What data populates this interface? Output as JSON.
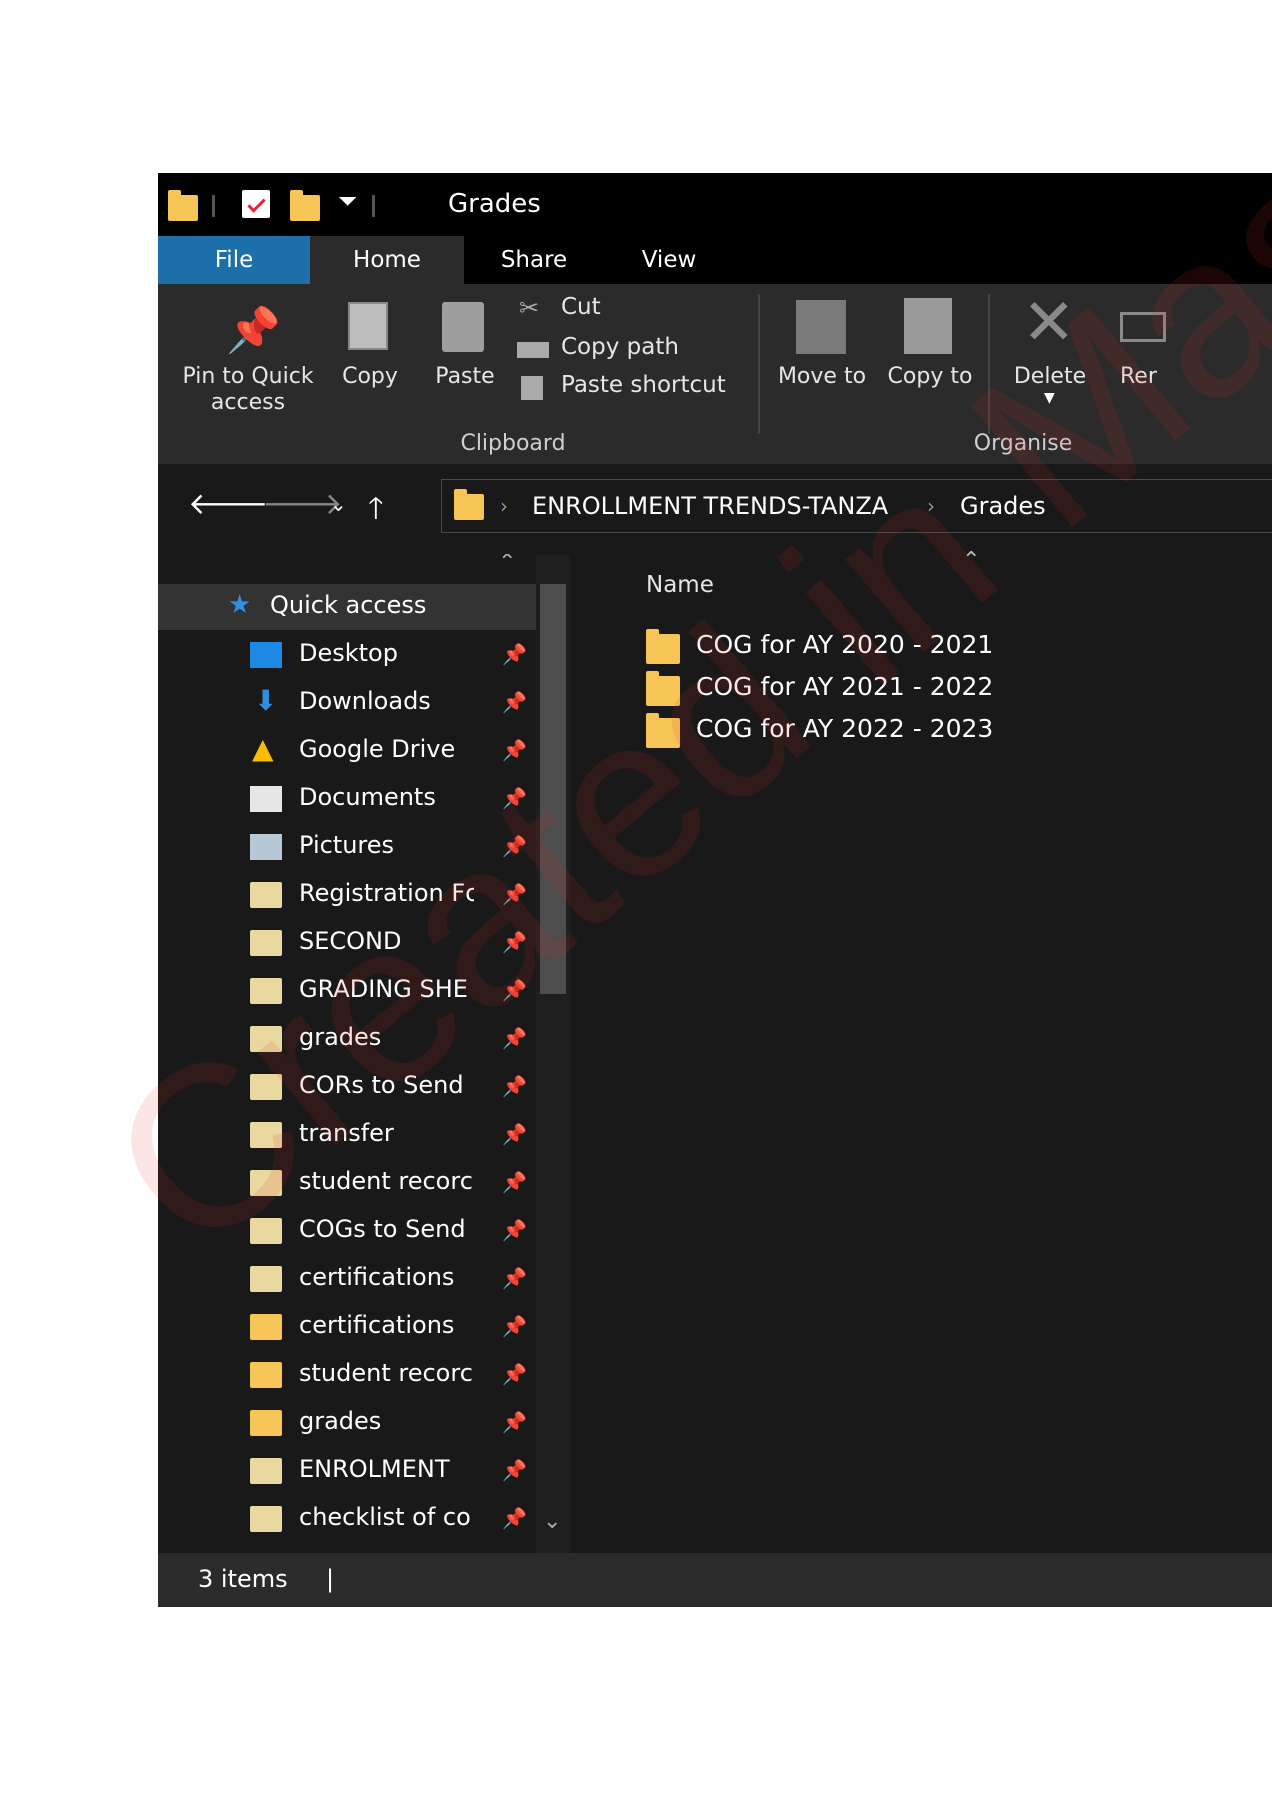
{
  "window": {
    "title": "Grades"
  },
  "tabs": [
    {
      "label": "File"
    },
    {
      "label": "Home"
    },
    {
      "label": "Share"
    },
    {
      "label": "View"
    }
  ],
  "ribbon": {
    "pin_label": "Pin to Quick access",
    "copy_label": "Copy",
    "paste_label": "Paste",
    "cut_label": "Cut",
    "copy_path_label": "Copy path",
    "paste_shortcut_label": "Paste shortcut",
    "clipboard_group": "Clipboard",
    "move_to_label": "Move to",
    "copy_to_label": "Copy to",
    "delete_label": "Delete",
    "rename_label": "Rer",
    "organise_group": "Organise"
  },
  "address": {
    "crumbs": [
      "ENROLLMENT TRENDS-TANZA",
      "Grades"
    ]
  },
  "navpane": {
    "quick_access": "Quick access",
    "items": [
      {
        "label": "Desktop",
        "icon": "desktop-icon"
      },
      {
        "label": "Downloads",
        "icon": "downloads-icon"
      },
      {
        "label": "Google Drive",
        "icon": "google-drive-icon"
      },
      {
        "label": "Documents",
        "icon": "documents-icon"
      },
      {
        "label": "Pictures",
        "icon": "pictures-icon"
      },
      {
        "label": "Registration Fc",
        "icon": "shared-folder-icon"
      },
      {
        "label": "SECOND",
        "icon": "cloud-folder-icon"
      },
      {
        "label": "GRADING SHE",
        "icon": "shared-folder-icon"
      },
      {
        "label": "grades",
        "icon": "cloud-folder-icon"
      },
      {
        "label": "CORs to Send",
        "icon": "shared-folder-icon"
      },
      {
        "label": "transfer",
        "icon": "cloud-folder-icon"
      },
      {
        "label": "student recorc",
        "icon": "cloud-folder-icon"
      },
      {
        "label": "COGs to Send",
        "icon": "shared-folder-icon"
      },
      {
        "label": "certifications",
        "icon": "cloud-folder-icon"
      },
      {
        "label": "certifications",
        "icon": "folder-icon"
      },
      {
        "label": "student recorc",
        "icon": "folder-icon"
      },
      {
        "label": "grades",
        "icon": "folder-icon"
      },
      {
        "label": "ENROLMENT",
        "icon": "cloud-folder-icon"
      },
      {
        "label": "checklist of co",
        "icon": "shared-folder-icon"
      }
    ]
  },
  "content": {
    "column_name": "Name",
    "files": [
      {
        "name": "COG for AY 2020 - 2021"
      },
      {
        "name": "COG for AY 2021 - 2022"
      },
      {
        "name": "COG for AY 2022 - 2023"
      }
    ]
  },
  "status": {
    "items": "3 items"
  },
  "watermark": "Created in Mas",
  "colors": {
    "accent": "#1c6fa8",
    "folder": "#f6c555",
    "bg": "#191919",
    "ribbon": "#2b2b2b"
  }
}
